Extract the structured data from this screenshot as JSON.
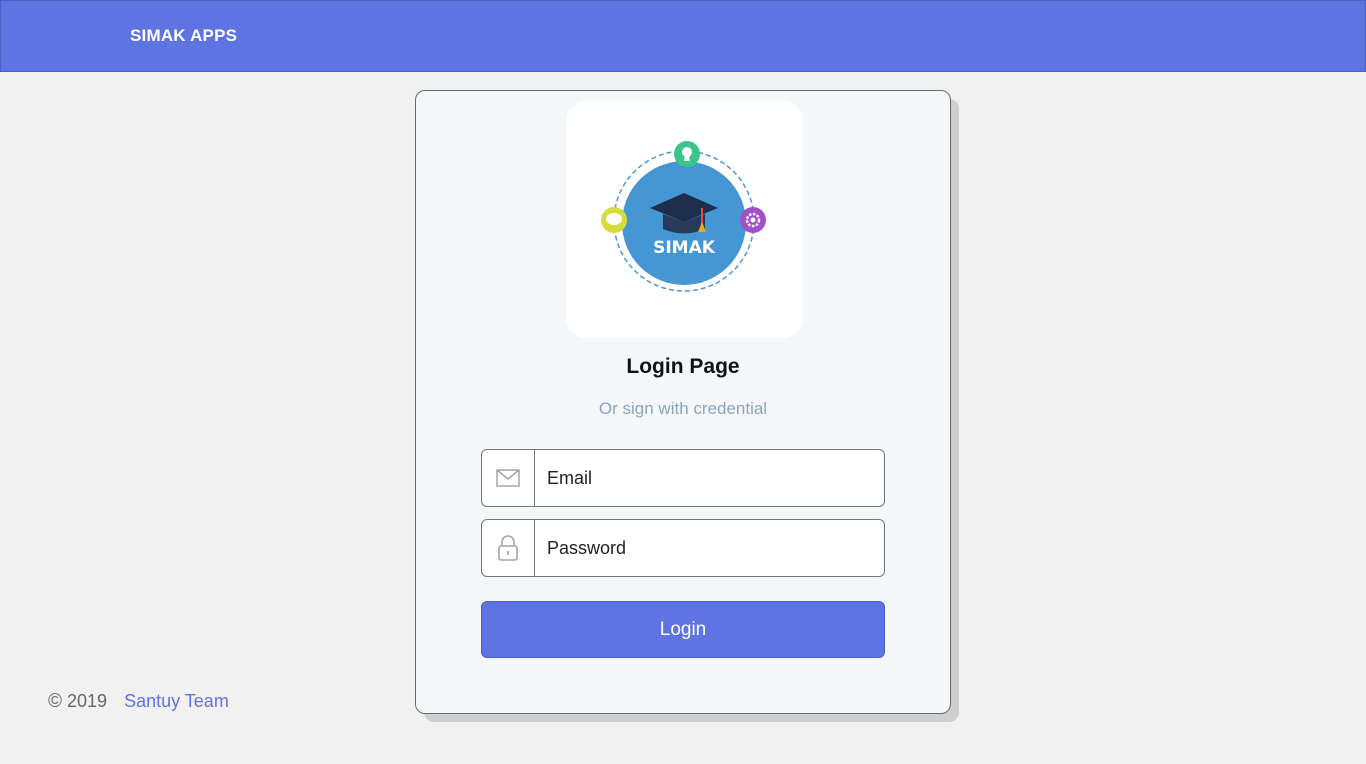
{
  "header": {
    "brand": "SIMAK APPS",
    "color": "#5f74e3"
  },
  "login_card": {
    "logo": {
      "icon": "simak-graduation-logo-icon",
      "text": "SIMAK"
    },
    "title": "Login Page",
    "subtitle": "Or sign with credential",
    "email": {
      "icon": "envelope-icon",
      "placeholder": "Email",
      "value": ""
    },
    "password": {
      "icon": "lock-icon",
      "placeholder": "Password",
      "value": ""
    },
    "login_button": "Login"
  },
  "footer": {
    "copyright_symbol": "©",
    "year": "2019",
    "team": "Santuy Team"
  }
}
